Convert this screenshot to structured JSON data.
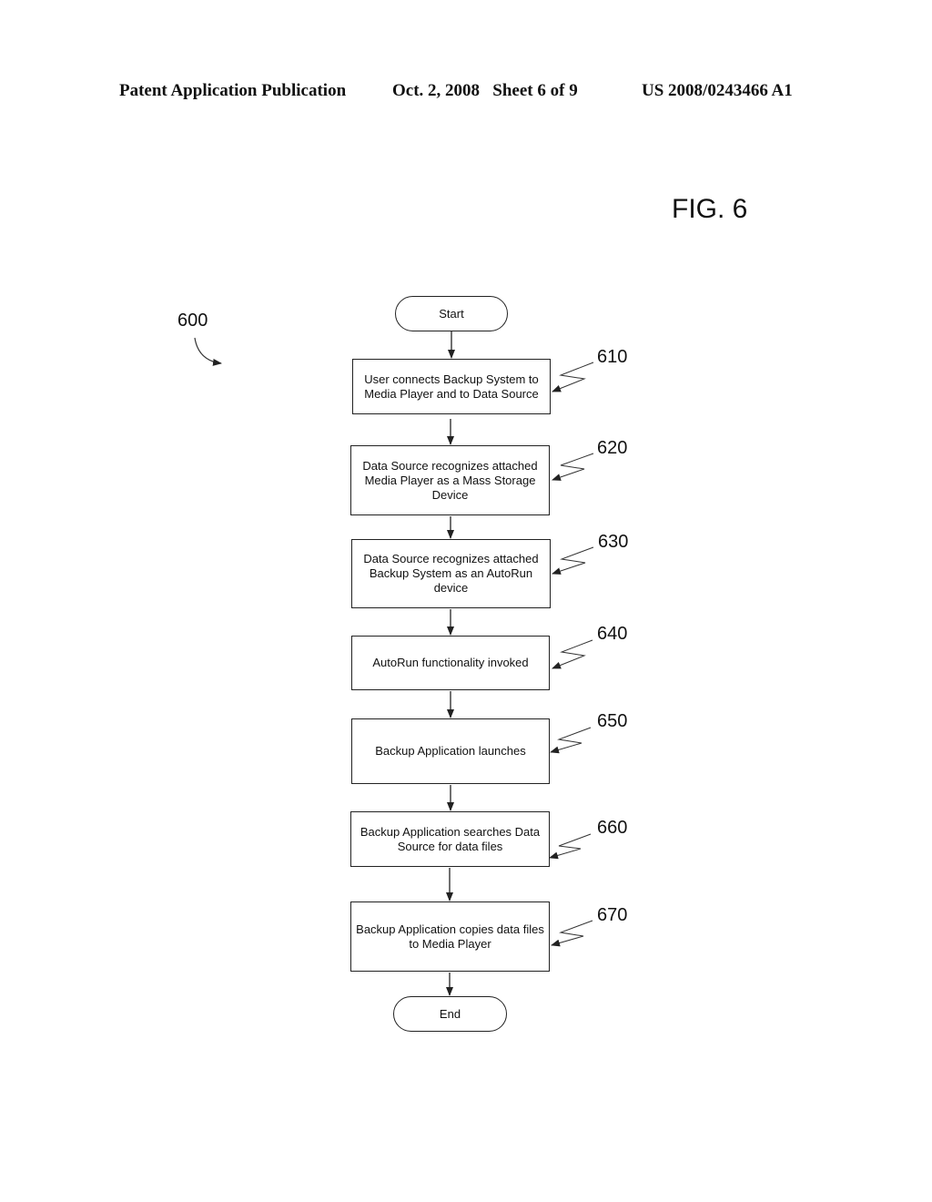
{
  "header": {
    "publication": "Patent Application Publication",
    "date_sheet": "Oct. 2, 2008   Sheet 6 of 9",
    "patent_number": "US 2008/0243466 A1"
  },
  "figure": {
    "label": "FIG. 6",
    "reference": "600"
  },
  "flowchart": {
    "start": "Start",
    "end": "End",
    "steps": [
      {
        "ref": "610",
        "text": "User connects Backup System to Media Player and to Data Source"
      },
      {
        "ref": "620",
        "text": "Data Source recognizes attached Media Player as a Mass Storage Device"
      },
      {
        "ref": "630",
        "text": "Data Source recognizes attached Backup System as an AutoRun device"
      },
      {
        "ref": "640",
        "text": "AutoRun functionality invoked"
      },
      {
        "ref": "650",
        "text": "Backup Application launches"
      },
      {
        "ref": "660",
        "text": "Backup Application searches Data Source for data files"
      },
      {
        "ref": "670",
        "text": "Backup Application copies data files to Media Player"
      }
    ]
  }
}
